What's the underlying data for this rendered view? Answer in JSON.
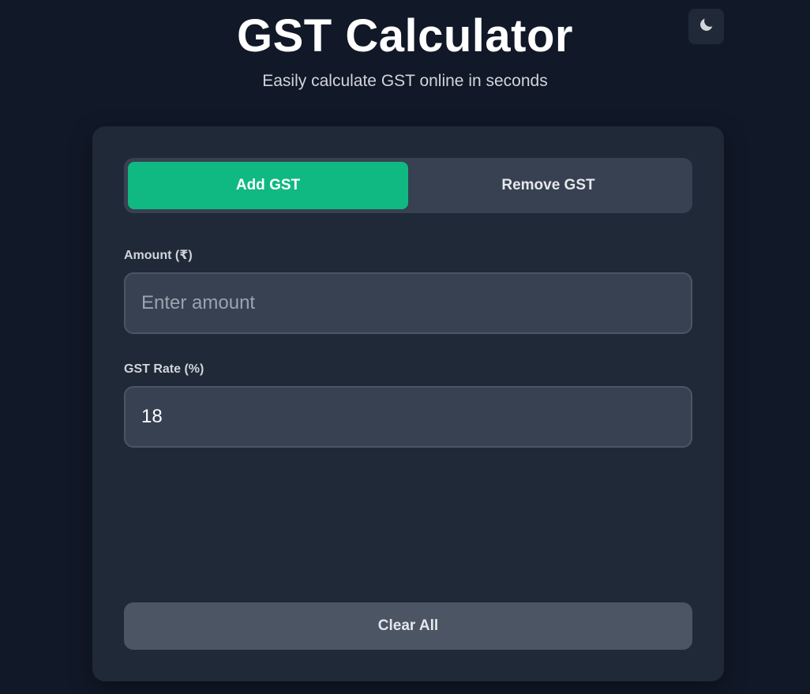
{
  "header": {
    "title": "GST Calculator",
    "subtitle": "Easily calculate GST online in seconds",
    "theme_toggle_icon": "moon-icon"
  },
  "tabs": [
    {
      "label": "Add GST",
      "active": true
    },
    {
      "label": "Remove GST",
      "active": false
    }
  ],
  "form": {
    "amount_label": "Amount (₹)",
    "amount_placeholder": "Enter amount",
    "amount_value": "",
    "rate_label": "GST Rate (%)",
    "rate_value": "18"
  },
  "actions": {
    "clear_label": "Clear All"
  },
  "colors": {
    "background": "#111827",
    "card": "#1f2937",
    "accent": "#10b981",
    "input": "#374151",
    "button": "#4b5563"
  }
}
